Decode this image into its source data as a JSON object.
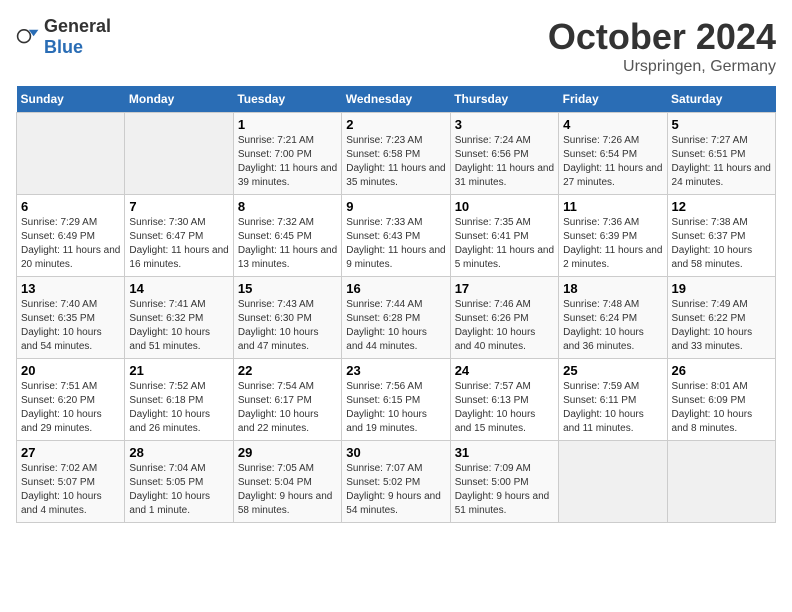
{
  "header": {
    "logo_general": "General",
    "logo_blue": "Blue",
    "month_year": "October 2024",
    "location": "Urspringen, Germany"
  },
  "weekdays": [
    "Sunday",
    "Monday",
    "Tuesday",
    "Wednesday",
    "Thursday",
    "Friday",
    "Saturday"
  ],
  "weeks": [
    [
      {
        "day": "",
        "empty": true
      },
      {
        "day": "",
        "empty": true
      },
      {
        "day": "1",
        "sunrise": "7:21 AM",
        "sunset": "7:00 PM",
        "daylight": "11 hours and 39 minutes."
      },
      {
        "day": "2",
        "sunrise": "7:23 AM",
        "sunset": "6:58 PM",
        "daylight": "11 hours and 35 minutes."
      },
      {
        "day": "3",
        "sunrise": "7:24 AM",
        "sunset": "6:56 PM",
        "daylight": "11 hours and 31 minutes."
      },
      {
        "day": "4",
        "sunrise": "7:26 AM",
        "sunset": "6:54 PM",
        "daylight": "11 hours and 27 minutes."
      },
      {
        "day": "5",
        "sunrise": "7:27 AM",
        "sunset": "6:51 PM",
        "daylight": "11 hours and 24 minutes."
      }
    ],
    [
      {
        "day": "6",
        "sunrise": "7:29 AM",
        "sunset": "6:49 PM",
        "daylight": "11 hours and 20 minutes."
      },
      {
        "day": "7",
        "sunrise": "7:30 AM",
        "sunset": "6:47 PM",
        "daylight": "11 hours and 16 minutes."
      },
      {
        "day": "8",
        "sunrise": "7:32 AM",
        "sunset": "6:45 PM",
        "daylight": "11 hours and 13 minutes."
      },
      {
        "day": "9",
        "sunrise": "7:33 AM",
        "sunset": "6:43 PM",
        "daylight": "11 hours and 9 minutes."
      },
      {
        "day": "10",
        "sunrise": "7:35 AM",
        "sunset": "6:41 PM",
        "daylight": "11 hours and 5 minutes."
      },
      {
        "day": "11",
        "sunrise": "7:36 AM",
        "sunset": "6:39 PM",
        "daylight": "11 hours and 2 minutes."
      },
      {
        "day": "12",
        "sunrise": "7:38 AM",
        "sunset": "6:37 PM",
        "daylight": "10 hours and 58 minutes."
      }
    ],
    [
      {
        "day": "13",
        "sunrise": "7:40 AM",
        "sunset": "6:35 PM",
        "daylight": "10 hours and 54 minutes."
      },
      {
        "day": "14",
        "sunrise": "7:41 AM",
        "sunset": "6:32 PM",
        "daylight": "10 hours and 51 minutes."
      },
      {
        "day": "15",
        "sunrise": "7:43 AM",
        "sunset": "6:30 PM",
        "daylight": "10 hours and 47 minutes."
      },
      {
        "day": "16",
        "sunrise": "7:44 AM",
        "sunset": "6:28 PM",
        "daylight": "10 hours and 44 minutes."
      },
      {
        "day": "17",
        "sunrise": "7:46 AM",
        "sunset": "6:26 PM",
        "daylight": "10 hours and 40 minutes."
      },
      {
        "day": "18",
        "sunrise": "7:48 AM",
        "sunset": "6:24 PM",
        "daylight": "10 hours and 36 minutes."
      },
      {
        "day": "19",
        "sunrise": "7:49 AM",
        "sunset": "6:22 PM",
        "daylight": "10 hours and 33 minutes."
      }
    ],
    [
      {
        "day": "20",
        "sunrise": "7:51 AM",
        "sunset": "6:20 PM",
        "daylight": "10 hours and 29 minutes."
      },
      {
        "day": "21",
        "sunrise": "7:52 AM",
        "sunset": "6:18 PM",
        "daylight": "10 hours and 26 minutes."
      },
      {
        "day": "22",
        "sunrise": "7:54 AM",
        "sunset": "6:17 PM",
        "daylight": "10 hours and 22 minutes."
      },
      {
        "day": "23",
        "sunrise": "7:56 AM",
        "sunset": "6:15 PM",
        "daylight": "10 hours and 19 minutes."
      },
      {
        "day": "24",
        "sunrise": "7:57 AM",
        "sunset": "6:13 PM",
        "daylight": "10 hours and 15 minutes."
      },
      {
        "day": "25",
        "sunrise": "7:59 AM",
        "sunset": "6:11 PM",
        "daylight": "10 hours and 11 minutes."
      },
      {
        "day": "26",
        "sunrise": "8:01 AM",
        "sunset": "6:09 PM",
        "daylight": "10 hours and 8 minutes."
      }
    ],
    [
      {
        "day": "27",
        "sunrise": "7:02 AM",
        "sunset": "5:07 PM",
        "daylight": "10 hours and 4 minutes."
      },
      {
        "day": "28",
        "sunrise": "7:04 AM",
        "sunset": "5:05 PM",
        "daylight": "10 hours and 1 minute."
      },
      {
        "day": "29",
        "sunrise": "7:05 AM",
        "sunset": "5:04 PM",
        "daylight": "9 hours and 58 minutes."
      },
      {
        "day": "30",
        "sunrise": "7:07 AM",
        "sunset": "5:02 PM",
        "daylight": "9 hours and 54 minutes."
      },
      {
        "day": "31",
        "sunrise": "7:09 AM",
        "sunset": "5:00 PM",
        "daylight": "9 hours and 51 minutes."
      },
      {
        "day": "",
        "empty": true
      },
      {
        "day": "",
        "empty": true
      }
    ]
  ]
}
